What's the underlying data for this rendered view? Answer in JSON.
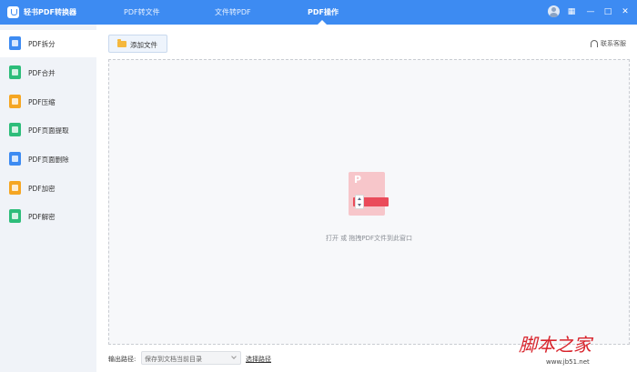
{
  "app": {
    "title": "轻书PDF转换器"
  },
  "nav": {
    "tabs": [
      {
        "label": "PDF转文件"
      },
      {
        "label": "文件转PDF"
      },
      {
        "label": "PDF操作"
      }
    ],
    "active_index": 2
  },
  "window": {
    "grid_icon": "▦",
    "minimize": "—",
    "maximize": "□",
    "close": "✕"
  },
  "sidebar": {
    "active_index": 0,
    "items": [
      {
        "label": "PDF拆分",
        "icon": "split-icon",
        "color": "#3d8bf2"
      },
      {
        "label": "PDF合并",
        "icon": "merge-icon",
        "color": "#2dbd7a"
      },
      {
        "label": "PDF压缩",
        "icon": "compress-icon",
        "color": "#f5a623"
      },
      {
        "label": "PDF页面提取",
        "icon": "extract-icon",
        "color": "#2dbd7a"
      },
      {
        "label": "PDF页面删除",
        "icon": "delete-page-icon",
        "color": "#3d8bf2"
      },
      {
        "label": "PDF加密",
        "icon": "lock-icon",
        "color": "#f5a623"
      },
      {
        "label": "PDF解密",
        "icon": "unlock-icon",
        "color": "#2dbd7a"
      }
    ]
  },
  "toolbar": {
    "add_files_label": "添加文件"
  },
  "support": {
    "label": "联系客服"
  },
  "dropzone": {
    "file_letter": "P",
    "hint": "打开 或 拖拽PDF文件到此窗口"
  },
  "output": {
    "label": "输出路径:",
    "selected": "保存到文档当前目录",
    "choose_label": "选择路径"
  },
  "watermark": {
    "main": "脚本之家",
    "sub": "www.jb51.net"
  },
  "colors": {
    "accent": "#3d8bf2",
    "sidebar_bg": "#f0f3f8",
    "pdf_red": "#ea4b5a"
  }
}
